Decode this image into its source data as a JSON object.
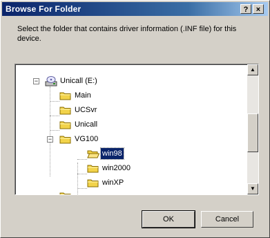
{
  "window": {
    "title": "Browse For Folder",
    "help_button": "?",
    "close_button": "×"
  },
  "description": "Select the folder that contains driver information (.INF file) for this device.",
  "tree": {
    "nodes": [
      {
        "label": "Unicall (E:)",
        "icon": "cd-drive-icon",
        "expander": "−"
      },
      {
        "label": "Main",
        "icon": "folder-icon"
      },
      {
        "label": "UCSvr",
        "icon": "folder-icon"
      },
      {
        "label": "Unicall",
        "icon": "folder-icon"
      },
      {
        "label": "VG100",
        "icon": "folder-icon",
        "expander": "−"
      },
      {
        "label": "win98",
        "icon": "open-folder-icon",
        "selected": true
      },
      {
        "label": "win2000",
        "icon": "folder-icon"
      },
      {
        "label": "winXP",
        "icon": "folder-icon"
      }
    ]
  },
  "scrollbar": {
    "up_arrow": "▲",
    "down_arrow": "▼"
  },
  "buttons": {
    "ok": "OK",
    "cancel": "Cancel"
  },
  "colors": {
    "title_gradient_start": "#0a246a",
    "title_gradient_end": "#a6caf0",
    "selection": "#0a246a",
    "face": "#d4d0c8",
    "folder": "#f2d34a"
  }
}
